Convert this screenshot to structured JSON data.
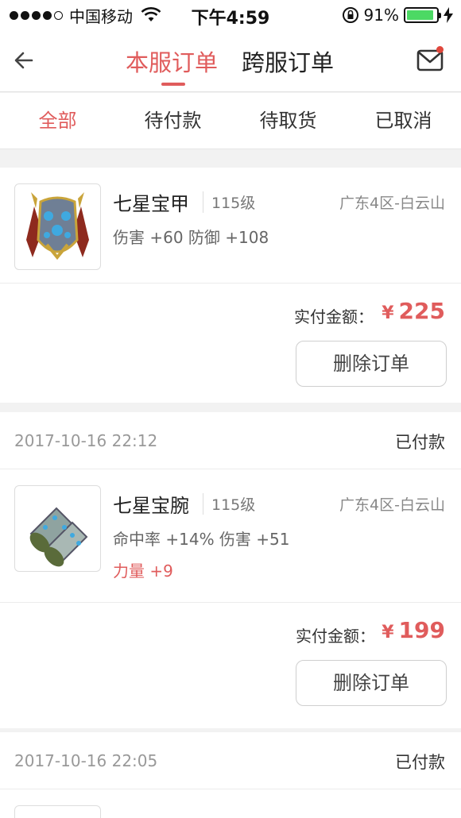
{
  "status_bar": {
    "carrier": "中国移动",
    "time": "下午4:59",
    "battery_percent": "91%",
    "battery_level": 0.91,
    "signal_icon": "signal-dots-icon",
    "wifi_icon": "wifi-icon",
    "lock_icon": "rotation-lock-icon",
    "charging_icon": "charging-bolt-icon"
  },
  "header": {
    "back_icon": "back-arrow-icon",
    "tabs": [
      {
        "label": "本服订单",
        "active": true
      },
      {
        "label": "跨服订单",
        "active": false
      }
    ],
    "mail_icon": "mail-icon"
  },
  "filters": [
    {
      "label": "全部",
      "active": true
    },
    {
      "label": "待付款",
      "active": false
    },
    {
      "label": "待取货",
      "active": false
    },
    {
      "label": "已取消",
      "active": false
    }
  ],
  "orders": [
    {
      "item": {
        "name": "七星宝甲",
        "level": "115级",
        "server": "广东4区-白云山",
        "attrs": "伤害 +60 防御 +108",
        "attrs_highlight": "",
        "icon": "armor-icon"
      },
      "pay_label": "实付金额：",
      "currency": "¥",
      "amount": "225",
      "delete_label": "删除订单"
    },
    {
      "date": "2017-10-16 22:12",
      "status": "已付款",
      "item": {
        "name": "七星宝腕",
        "level": "115级",
        "server": "广东4区-白云山",
        "attrs": "命中率 +14% 伤害 +51",
        "attrs_highlight": "力量 +9",
        "icon": "bracer-icon"
      },
      "pay_label": "实付金额：",
      "currency": "¥",
      "amount": "199",
      "delete_label": "删除订单"
    },
    {
      "date": "2017-10-16 22:05",
      "status": "已付款"
    }
  ],
  "colors": {
    "accent": "#e05c5c",
    "background": "#f2f2f2",
    "battery": "#4cd964"
  }
}
